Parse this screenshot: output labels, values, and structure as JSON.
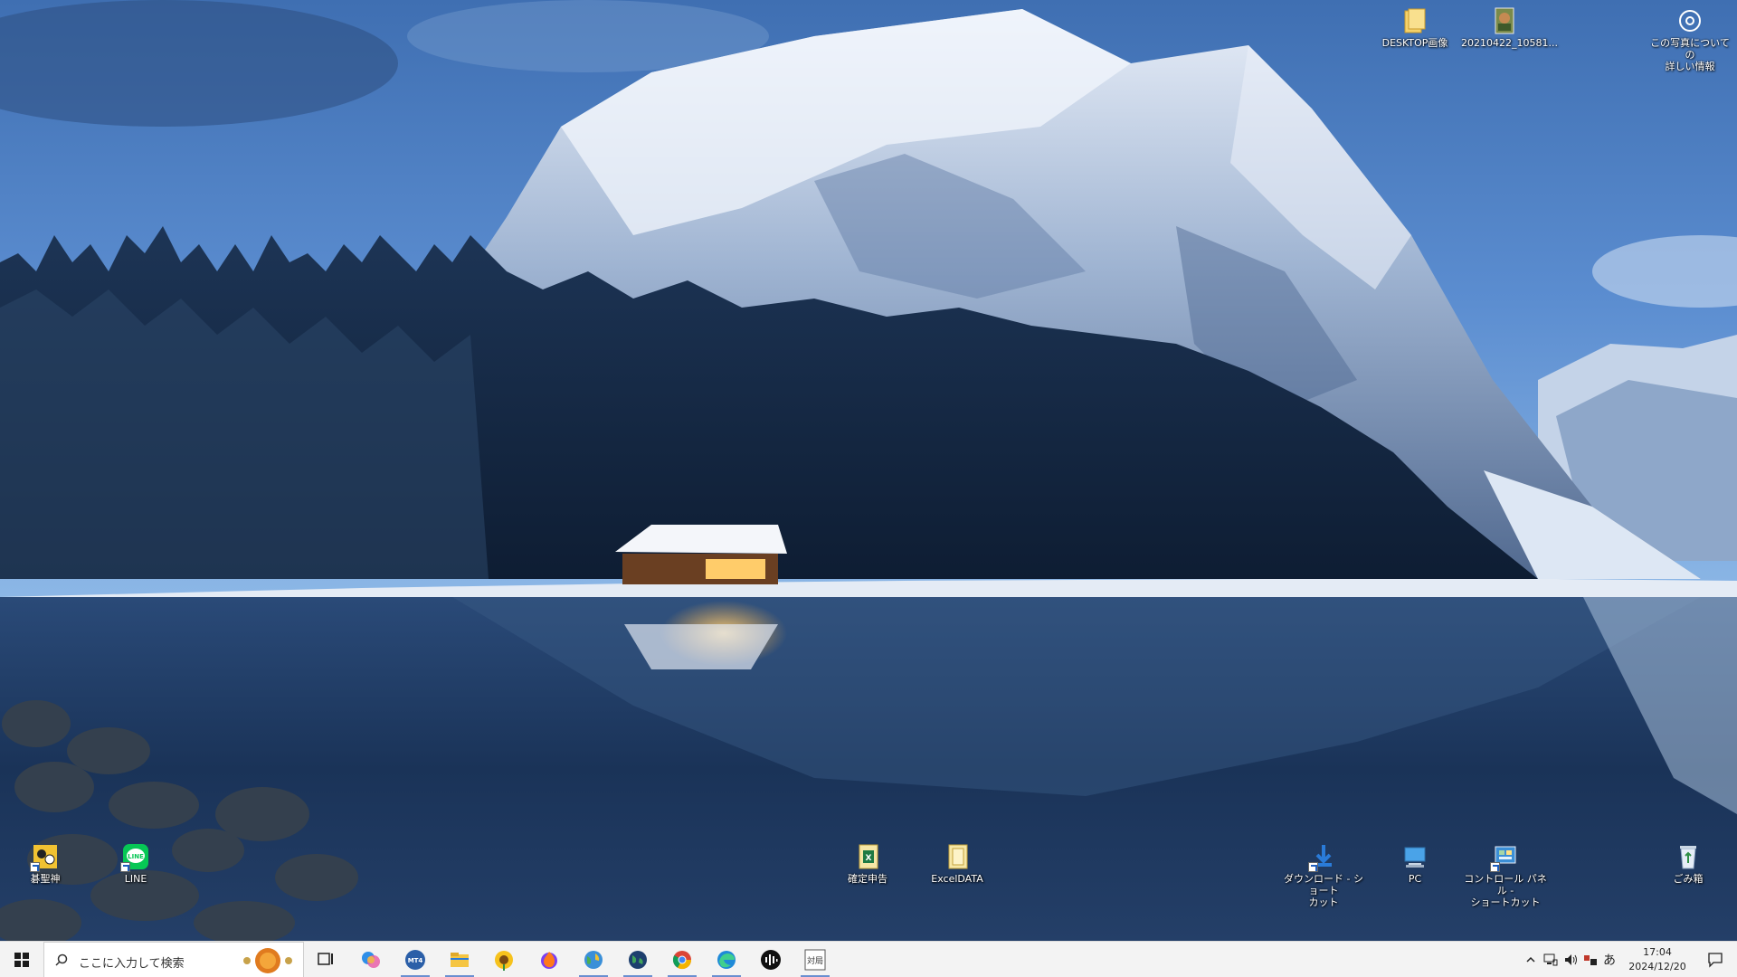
{
  "desktop": {
    "top_icons": [
      {
        "label": "DESKTOP画像",
        "icon": "folder-icon"
      },
      {
        "label": "20210422_10581...",
        "icon": "image-file-icon"
      },
      {
        "label_line1": "この写真についての",
        "label_line2": "詳しい情報",
        "icon": "camera-info-icon"
      }
    ],
    "bottom_icons": [
      {
        "label": "碁聖神",
        "icon": "go-game-icon"
      },
      {
        "label": "LINE",
        "icon": "line-app-icon"
      },
      {
        "label": "確定申告",
        "icon": "excel-file-icon"
      },
      {
        "label": "ExcelDATA",
        "icon": "folder-icon"
      },
      {
        "label_line1": "ダウンロード - ショート",
        "label_line2": "カット",
        "icon": "download-folder-icon"
      },
      {
        "label": "PC",
        "icon": "pc-icon"
      },
      {
        "label_line1": "コントロール パネル -",
        "label_line2": "ショートカット",
        "icon": "control-panel-icon"
      },
      {
        "label": "ごみ箱",
        "icon": "recycle-bin-icon"
      }
    ]
  },
  "taskbar": {
    "search_placeholder": "ここに入力して検索",
    "apps": [
      {
        "name": "task-view",
        "icon": "task-view-icon"
      },
      {
        "name": "copilot",
        "icon": "copilot-icon"
      },
      {
        "name": "mt4",
        "icon": "mt4-icon",
        "text": "MT4"
      },
      {
        "name": "file-explorer",
        "icon": "folder-icon"
      },
      {
        "name": "sunflower-app",
        "icon": "sunflower-icon"
      },
      {
        "name": "firefox",
        "icon": "flame-icon"
      },
      {
        "name": "globe-app",
        "icon": "globe-icon"
      },
      {
        "name": "earth-app",
        "icon": "earth-icon"
      },
      {
        "name": "chrome",
        "icon": "chrome-icon"
      },
      {
        "name": "edge",
        "icon": "edge-icon"
      },
      {
        "name": "audio-app",
        "icon": "waveform-icon"
      },
      {
        "name": "go-board-app",
        "icon": "go-board-icon",
        "text": "対局"
      }
    ],
    "tray": {
      "ime_indicator": "あ",
      "time": "17:04",
      "date": "2024/12/20"
    }
  }
}
